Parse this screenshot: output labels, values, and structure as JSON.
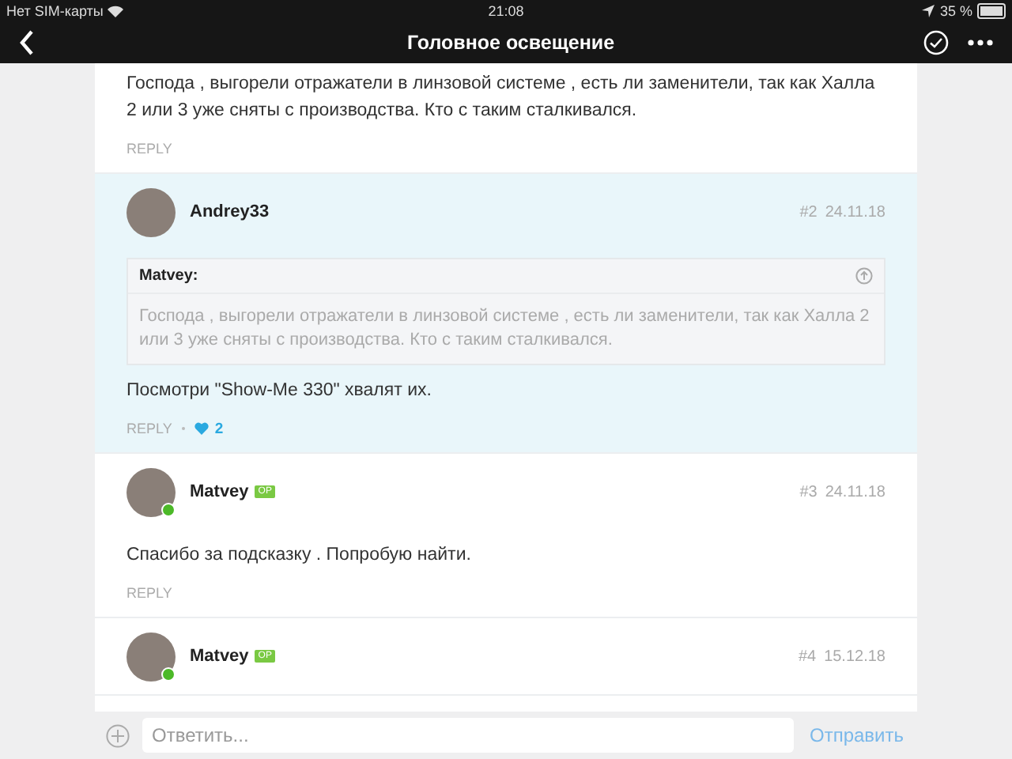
{
  "status_bar": {
    "carrier": "Нет SIM-карты",
    "time": "21:08",
    "battery": "35 %"
  },
  "nav": {
    "title": "Головное освещение"
  },
  "posts": [
    {
      "body": "Господа , выгорели отражатели в линзовой системе , есть ли заменители, так как Халла 2 или 3 уже сняты с производства. Кто с таким сталкивался.",
      "actions": {
        "reply": "REPLY"
      },
      "highlighted": false
    },
    {
      "author": "Andrey33",
      "online": false,
      "number": "#2",
      "date": "24.11.18",
      "quote": {
        "author": "Matvey:",
        "text": "Господа , выгорели отражатели в линзовой системе , есть ли заменители, так как Халла 2 или 3 уже сняты с производства. Кто с таким сталкивался."
      },
      "body": "Посмотри \"Show-Me 330\" хвалят их.",
      "actions": {
        "reply": "REPLY",
        "likes": "2"
      },
      "highlighted": true
    },
    {
      "author": "Matvey",
      "online": true,
      "badge": "OP",
      "number": "#3",
      "date": "24.11.18",
      "body": "Спасибо за подсказку . Попробую найти.",
      "actions": {
        "reply": "REPLY"
      },
      "highlighted": false
    },
    {
      "author": "Matvey",
      "online": true,
      "badge": "OP",
      "number": "#4",
      "date": "15.12.18",
      "highlighted": false
    }
  ],
  "composer": {
    "placeholder": "Ответить...",
    "send": "Отправить"
  }
}
